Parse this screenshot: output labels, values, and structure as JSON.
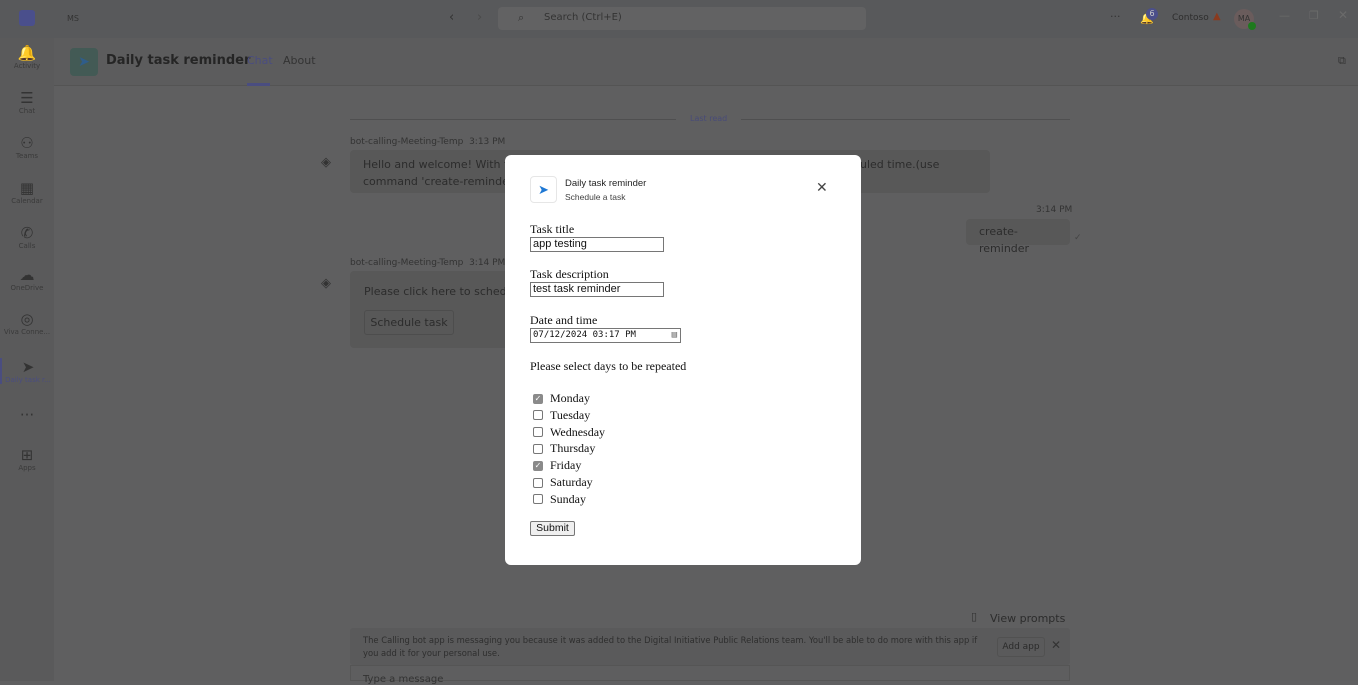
{
  "topbar": {
    "org": "MS",
    "search_placeholder": "Search (Ctrl+E)",
    "notifications": "6",
    "tenant": "Contoso",
    "avatar": "MA"
  },
  "rail": [
    {
      "label": "Activity",
      "icon": "bell-icon",
      "g": "🔔"
    },
    {
      "label": "Chat",
      "icon": "chat-icon",
      "g": "☰"
    },
    {
      "label": "Teams",
      "icon": "teams-icon",
      "g": "⚇"
    },
    {
      "label": "Calendar",
      "icon": "calendar-icon",
      "g": "▦"
    },
    {
      "label": "Calls",
      "icon": "phone-icon",
      "g": "✆"
    },
    {
      "label": "OneDrive",
      "icon": "cloud-icon",
      "g": "☁"
    },
    {
      "label": "Viva Conne...",
      "icon": "viva-icon",
      "g": "◎"
    },
    {
      "label": "Daily task r...",
      "icon": "app-icon",
      "g": "➤"
    },
    {
      "label": "",
      "icon": "more-icon",
      "g": "···"
    },
    {
      "label": "Apps",
      "icon": "add-apps-icon",
      "g": "⊞"
    }
  ],
  "header": {
    "title": "Daily task reminder",
    "tabs": [
      "Chat",
      "About"
    ]
  },
  "chat": {
    "last_read": "Last read",
    "m1": {
      "sender": "bot-calling-Meeting-Temp",
      "time": "3:13 PM",
      "text_left": "Hello and welcome! With this",
      "text_right": "uled time.(use",
      "text_line2": "command 'create-reminder')."
    },
    "m2": {
      "time": "3:14 PM",
      "text": "create-reminder"
    },
    "m3": {
      "sender": "bot-calling-Meeting-Temp",
      "time": "3:14 PM",
      "text": "Please click here to schedule",
      "button": "Schedule task"
    },
    "view_prompts": "View prompts",
    "banner": "The Calling bot app is messaging you because it was added to the Digital Initiative Public Relations team. You'll be able to do more with this app if you add it for your personal use.",
    "add_app": "Add app",
    "compose_placeholder": "Type a message"
  },
  "dialog": {
    "app_name": "Daily task reminder",
    "subtitle": "Schedule a task",
    "title_label": "Task title",
    "title_value": "app testing",
    "desc_label": "Task description",
    "desc_value": "test task reminder",
    "date_label": "Date and time",
    "date_value": "07/12/2024 03:17 PM",
    "days_label": "Please select days to be repeated",
    "days": [
      {
        "name": "Monday",
        "checked": true
      },
      {
        "name": "Tuesday",
        "checked": false
      },
      {
        "name": "Wednesday",
        "checked": false
      },
      {
        "name": "Thursday",
        "checked": false
      },
      {
        "name": "Friday",
        "checked": true
      },
      {
        "name": "Saturday",
        "checked": false
      },
      {
        "name": "Sunday",
        "checked": false
      }
    ],
    "submit": "Submit"
  },
  "colors": {
    "accent": "#5b5fc7",
    "overlay": "#606061",
    "dialog": "#ffffff"
  }
}
